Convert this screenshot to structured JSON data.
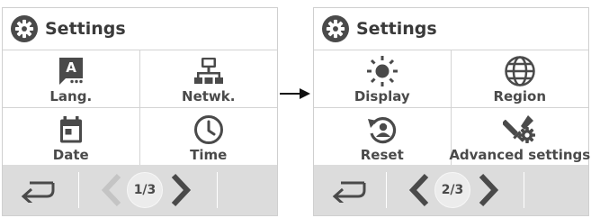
{
  "screens": [
    {
      "header": {
        "title": "Settings",
        "icon": "gear-icon"
      },
      "items": [
        {
          "label": "Lang.",
          "icon": "language-icon"
        },
        {
          "label": "Netwk.",
          "icon": "network-icon"
        },
        {
          "label": "Date",
          "icon": "calendar-icon"
        },
        {
          "label": "Time",
          "icon": "clock-icon"
        }
      ],
      "footer": {
        "page": "1/3",
        "prev_enabled": false,
        "next_enabled": true
      }
    },
    {
      "header": {
        "title": "Settings",
        "icon": "gear-icon"
      },
      "items": [
        {
          "label": "Display",
          "icon": "brightness-icon"
        },
        {
          "label": "Region",
          "icon": "globe-icon"
        },
        {
          "label": "Reset",
          "icon": "reset-icon"
        },
        {
          "label": "Advanced settings",
          "icon": "tools-icon"
        }
      ],
      "footer": {
        "page": "2/3",
        "prev_enabled": true,
        "next_enabled": true
      }
    }
  ],
  "colors": {
    "icon": "#4a4a4a",
    "footer_bg": "#dcdcdc",
    "disabled_chevron": "#c4c4c4",
    "divider": "#d3d3d3"
  }
}
